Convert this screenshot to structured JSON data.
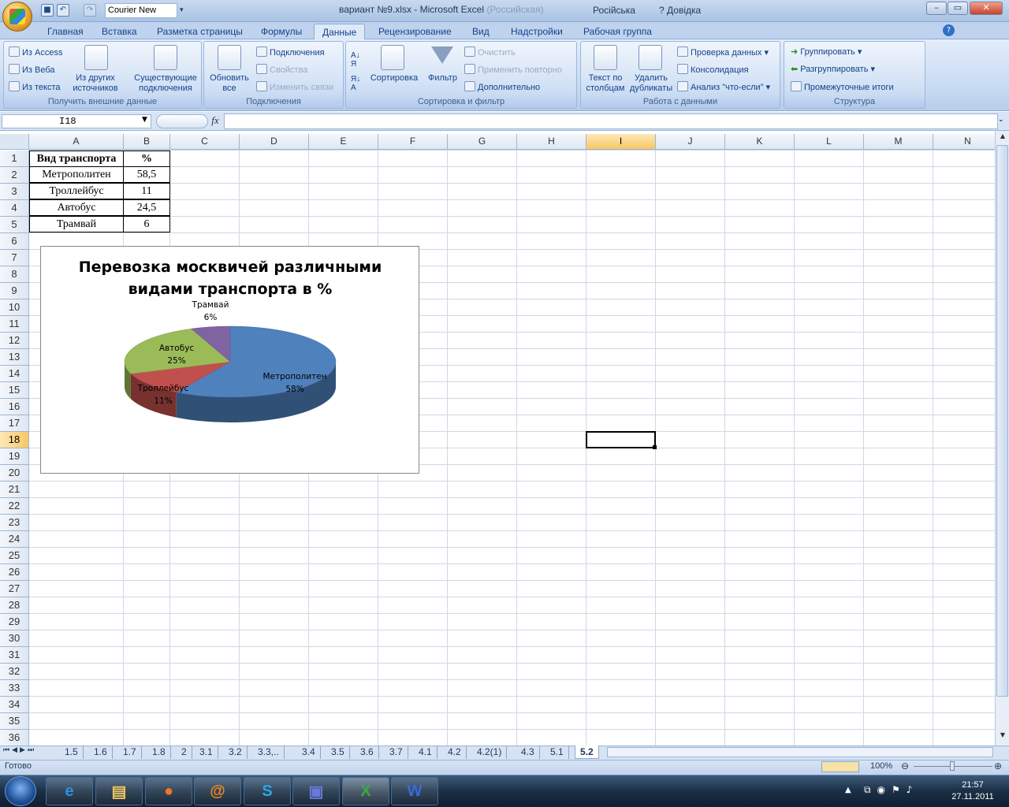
{
  "window": {
    "title_main": "вариант №9.xlsx - Microsoft Excel",
    "title_dim": "(Российская)",
    "lang_label": "Російська",
    "help_label": "Довідка"
  },
  "qat": {
    "font_name": "Courier New"
  },
  "tabs": [
    "Главная",
    "Вставка",
    "Разметка страницы",
    "Формулы",
    "Данные",
    "Рецензирование",
    "Вид",
    "Надстройки",
    "Рабочая группа"
  ],
  "ribbon": {
    "ext": {
      "access": "Из Access",
      "web": "Из Веба",
      "text": "Из текста",
      "other": "Из других источников",
      "existing": "Существующие подключения",
      "label": "Получить внешние данные"
    },
    "conn": {
      "refresh": "Обновить все",
      "connections": "Подключения",
      "props": "Свойства",
      "edit_links": "Изменить связи",
      "label": "Подключения"
    },
    "sort": {
      "sort": "Сортировка",
      "filter": "Фильтр",
      "clear": "Очистить",
      "reapply": "Применить повторно",
      "advanced": "Дополнительно",
      "label": "Сортировка и фильтр"
    },
    "data": {
      "text_cols": "Текст по столбцам",
      "dup": "Удалить дубликаты",
      "validation": "Проверка данных",
      "consolidate": "Консолидация",
      "whatif": "Анализ \"что-если\"",
      "label": "Работа с данными"
    },
    "outline": {
      "group": "Группировать",
      "ungroup": "Разгруппировать",
      "subtotal": "Промежуточные итоги",
      "label": "Структура"
    }
  },
  "namebox": "I18",
  "columns": [
    "A",
    "B",
    "C",
    "D",
    "E",
    "F",
    "G",
    "H",
    "I",
    "J",
    "K",
    "L",
    "M",
    "N"
  ],
  "rows": [
    "1",
    "2",
    "3",
    "4",
    "5",
    "6",
    "7",
    "8",
    "9",
    "10",
    "11",
    "12",
    "13",
    "14",
    "15",
    "16",
    "17",
    "18",
    "19",
    "20",
    "21",
    "22",
    "23",
    "24",
    "25",
    "26",
    "27",
    "28",
    "29",
    "30",
    "31",
    "32",
    "33",
    "34",
    "35",
    "36"
  ],
  "table": {
    "header": [
      "Вид транспорта",
      "%"
    ],
    "rows": [
      [
        "Метрополитен",
        "58,5"
      ],
      [
        "Троллейбус",
        "11"
      ],
      [
        "Автобус",
        "24,5"
      ],
      [
        "Трамвай",
        "6"
      ]
    ]
  },
  "chart_data": {
    "type": "pie",
    "title": "Перевозка москвичей различными видами транспорта в %",
    "categories": [
      "Метрополитен",
      "Троллейбус",
      "Автобус",
      "Трамвай"
    ],
    "values": [
      58.5,
      11,
      24.5,
      6
    ],
    "data_labels": [
      "58%",
      "11%",
      "25%",
      "6%"
    ],
    "colors": [
      "#4f81bd",
      "#c0504d",
      "#9bbb59",
      "#8064a2"
    ],
    "legend": "none"
  },
  "sheets": [
    "1.5",
    "1.6",
    "1.7",
    "1.8",
    "2",
    "3.1",
    "3.2",
    "3.3,..",
    "3.4",
    "3.5",
    "3.6",
    "3.7",
    "4.1",
    "4.2",
    "4.2(1)",
    "4.3",
    "5.1",
    "5.2"
  ],
  "active_sheet": "5.2",
  "status": {
    "ready": "Готово",
    "zoom": "100%"
  },
  "tray": {
    "time": "21:57",
    "date": "27.11.2011"
  }
}
